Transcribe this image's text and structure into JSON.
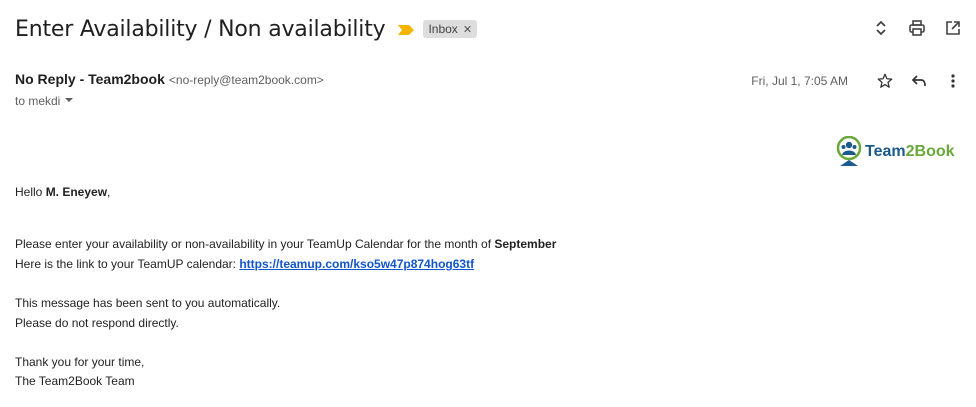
{
  "subject": "Enter Availability / Non availability",
  "label": "Inbox",
  "sender": {
    "name": "No Reply - Team2book",
    "email": "<no-reply@team2book.com>"
  },
  "recipient": "to mekdi",
  "date": "Fri, Jul 1, 7:05 AM",
  "logo": {
    "part1": "Team",
    "part2": "2Book"
  },
  "body": {
    "greeting_prefix": "Hello ",
    "greeting_name": "M. Eneyew",
    "greeting_suffix": ",",
    "line1_prefix": "Please enter your availability or non-availability in your TeamUp Calendar for the month of ",
    "line1_month": "September",
    "line2_prefix": "Here is the link to your TeamUP calendar: ",
    "link": "https://teamup.com/kso5w47p874hog63tf",
    "line3": "This message has been sent to you automatically.",
    "line4": "Please do not respond directly.",
    "line5": "Thank you for your time,",
    "line6": "The Team2Book Team"
  },
  "colors": {
    "importance": "#f4b400",
    "link": "#1155cc",
    "logo_blue": "#1a5b8c",
    "logo_green": "#6aa83a"
  },
  "icons": [
    "importance-marker-icon",
    "expand-collapse-icon",
    "print-icon",
    "open-new-window-icon",
    "star-icon",
    "reply-icon",
    "more-vert-icon",
    "chevron-down-icon",
    "close-icon"
  ]
}
